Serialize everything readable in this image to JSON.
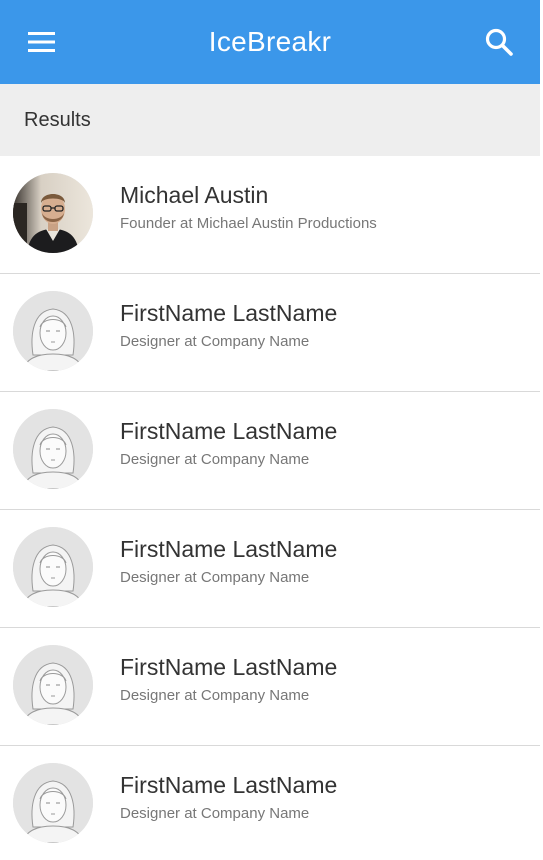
{
  "app": {
    "title": "IceBreakr",
    "menu_icon": "hamburger-menu-icon",
    "search_icon": "search-icon",
    "accent_color": "#3b97ea"
  },
  "results": {
    "label": "Results"
  },
  "people": [
    {
      "name": "Michael Austin",
      "subtitle": "Founder at Michael Austin Productions",
      "avatar": "photo"
    },
    {
      "name": "FirstName LastName",
      "subtitle": "Designer at Company Name",
      "avatar": "placeholder"
    },
    {
      "name": "FirstName LastName",
      "subtitle": "Designer at Company Name",
      "avatar": "placeholder"
    },
    {
      "name": "FirstName LastName",
      "subtitle": "Designer at Company Name",
      "avatar": "placeholder"
    },
    {
      "name": "FirstName LastName",
      "subtitle": "Designer at Company Name",
      "avatar": "placeholder"
    },
    {
      "name": "FirstName LastName",
      "subtitle": "Designer at Company Name",
      "avatar": "placeholder"
    }
  ]
}
